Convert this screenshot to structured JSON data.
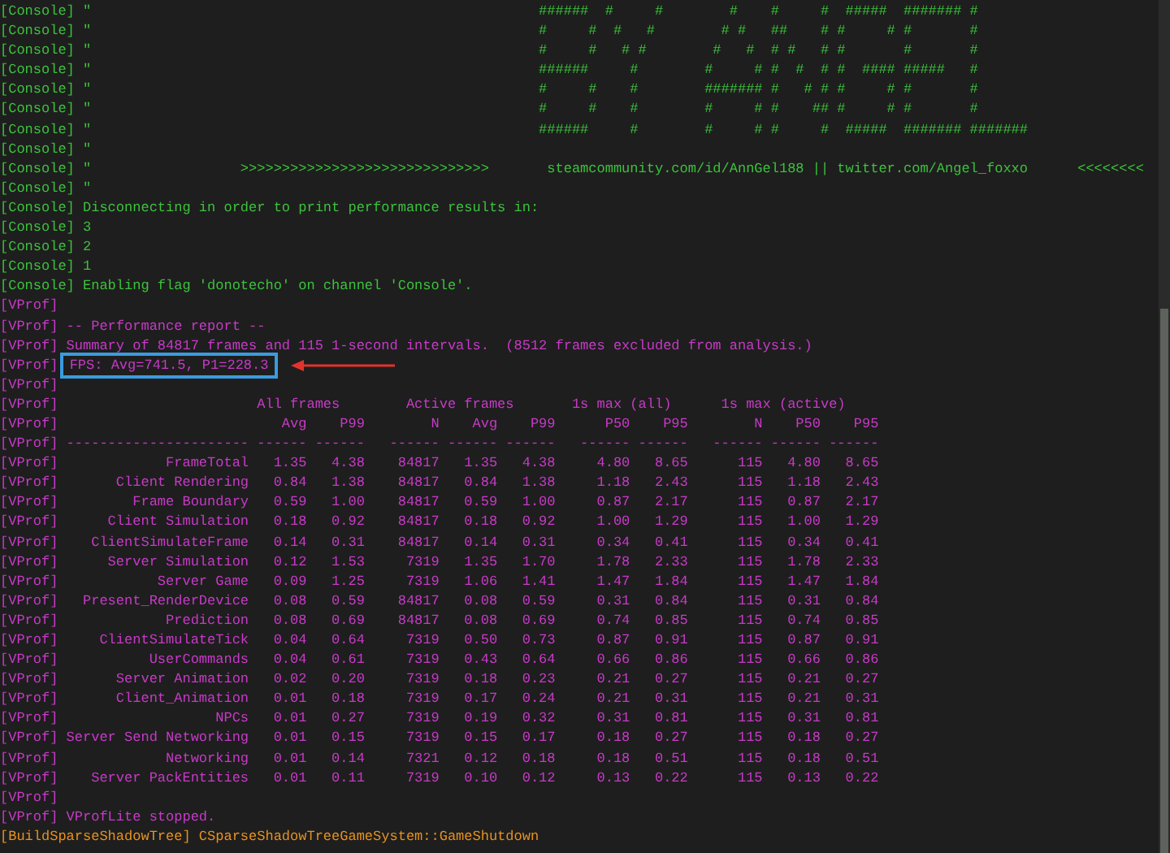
{
  "console_log": [
    {
      "kind": "text",
      "color": "#3cc23c",
      "tag": "[Console]",
      "text": "\"                                                      ######  #     #        #    #     #  #####  ####### #",
      "highlighted": false
    },
    {
      "kind": "text",
      "color": "#3cc23c",
      "tag": "[Console]",
      "text": "\"                                                      #     #  #   #        # #   ##    # #     # #       #",
      "highlighted": false
    },
    {
      "kind": "text",
      "color": "#3cc23c",
      "tag": "[Console]",
      "text": "\"                                                      #     #   # #        #   #  # #   # #       #       #",
      "highlighted": false
    },
    {
      "kind": "text",
      "color": "#3cc23c",
      "tag": "[Console]",
      "text": "\"                                                      ######     #        #     # #  #  # #  #### #####   #",
      "highlighted": false
    },
    {
      "kind": "text",
      "color": "#3cc23c",
      "tag": "[Console]",
      "text": "\"                                                      #     #    #        ####### #   # # #     # #       #",
      "highlighted": false
    },
    {
      "kind": "text",
      "color": "#3cc23c",
      "tag": "[Console]",
      "text": "\"                                                      #     #    #        #     # #    ## #     # #       #",
      "highlighted": false
    },
    {
      "kind": "text",
      "color": "#3cc23c",
      "tag": "[Console]",
      "text": "\"                                                      ######     #        #     # #     #  #####  ####### #######",
      "highlighted": false
    },
    {
      "kind": "text",
      "color": "#3cc23c",
      "tag": "[Console]",
      "text": "\"",
      "highlighted": false
    },
    {
      "kind": "text",
      "color": "#3cc23c",
      "tag": "[Console]",
      "text": "\"                  >>>>>>>>>>>>>>>>>>>>>>>>>>>>>>       steamcommunity.com/id/AnnGel188 || twitter.com/Angel_foxxo      <<<<<<<<",
      "highlighted": false
    },
    {
      "kind": "text",
      "color": "#3cc23c",
      "tag": "[Console]",
      "text": "\"",
      "highlighted": false
    },
    {
      "kind": "text",
      "color": "#3cc23c",
      "tag": "[Console]",
      "text": "Disconnecting in order to print performance results in:",
      "highlighted": false
    },
    {
      "kind": "text",
      "color": "#3cc23c",
      "tag": "[Console]",
      "text": "3",
      "highlighted": false
    },
    {
      "kind": "text",
      "color": "#3cc23c",
      "tag": "[Console]",
      "text": "2",
      "highlighted": false
    },
    {
      "kind": "text",
      "color": "#3cc23c",
      "tag": "[Console]",
      "text": "1",
      "highlighted": false
    },
    {
      "kind": "text",
      "color": "#3cc23c",
      "tag": "[Console]",
      "text": "Enabling flag 'donotecho' on channel 'Console'.",
      "highlighted": false
    },
    {
      "kind": "text",
      "color": "#c83ac8",
      "tag": "[VProf]",
      "highlighted": false
    },
    {
      "kind": "text",
      "color": "#c83ac8",
      "tag": "[VProf]",
      "text": "-- Performance report --",
      "highlighted": false
    },
    {
      "kind": "text",
      "color": "#c83ac8",
      "tag": "[VProf]",
      "text": "Summary of 84817 frames and 115 1-second intervals.  (8512 frames excluded from analysis.)",
      "highlighted": false
    },
    {
      "kind": "text",
      "color": "#c83ac8",
      "tag": "[VProf]",
      "text": "FPS: Avg=741.5, P1=228.3",
      "highlighted": true
    },
    {
      "kind": "text",
      "color": "#c83ac8",
      "tag": "[VProf]",
      "highlighted": false
    },
    {
      "kind": "groups",
      "color": "#c83ac8",
      "tag": "[VProf]",
      "groups": [
        "All frames",
        "Active frames",
        "1s max (all)",
        "1s max (active)"
      ]
    },
    {
      "kind": "columns",
      "color": "#c83ac8",
      "tag": "[VProf]",
      "columns": [
        "Avg",
        "P99",
        "N",
        "Avg",
        "P99",
        "P50",
        "P95",
        "N",
        "P50",
        "P95"
      ]
    },
    {
      "kind": "separator",
      "color": "#c83ac8",
      "tag": "[VProf]",
      "name": "----------------------",
      "values": [
        "------",
        "------",
        "------",
        "------",
        "------",
        "------",
        "------",
        "------",
        "------",
        "------"
      ]
    },
    {
      "kind": "row",
      "color": "#c83ac8",
      "tag": "[VProf]",
      "name": "FrameTotal",
      "values": [
        "1.35",
        "4.38",
        "84817",
        "1.35",
        "4.38",
        "4.80",
        "8.65",
        "115",
        "4.80",
        "8.65"
      ]
    },
    {
      "kind": "row",
      "color": "#c83ac8",
      "tag": "[VProf]",
      "name": "Client Rendering",
      "values": [
        "0.84",
        "1.38",
        "84817",
        "0.84",
        "1.38",
        "1.18",
        "2.43",
        "115",
        "1.18",
        "2.43"
      ]
    },
    {
      "kind": "row",
      "color": "#c83ac8",
      "tag": "[VProf]",
      "name": "Frame Boundary",
      "values": [
        "0.59",
        "1.00",
        "84817",
        "0.59",
        "1.00",
        "0.87",
        "2.17",
        "115",
        "0.87",
        "2.17"
      ]
    },
    {
      "kind": "row",
      "color": "#c83ac8",
      "tag": "[VProf]",
      "name": "Client Simulation",
      "values": [
        "0.18",
        "0.92",
        "84817",
        "0.18",
        "0.92",
        "1.00",
        "1.29",
        "115",
        "1.00",
        "1.29"
      ]
    },
    {
      "kind": "row",
      "color": "#c83ac8",
      "tag": "[VProf]",
      "name": "ClientSimulateFrame",
      "values": [
        "0.14",
        "0.31",
        "84817",
        "0.14",
        "0.31",
        "0.34",
        "0.41",
        "115",
        "0.34",
        "0.41"
      ]
    },
    {
      "kind": "row",
      "color": "#c83ac8",
      "tag": "[VProf]",
      "name": "Server Simulation",
      "values": [
        "0.12",
        "1.53",
        "7319",
        "1.35",
        "1.70",
        "1.78",
        "2.33",
        "115",
        "1.78",
        "2.33"
      ]
    },
    {
      "kind": "row",
      "color": "#c83ac8",
      "tag": "[VProf]",
      "name": "Server Game",
      "values": [
        "0.09",
        "1.25",
        "7319",
        "1.06",
        "1.41",
        "1.47",
        "1.84",
        "115",
        "1.47",
        "1.84"
      ]
    },
    {
      "kind": "row",
      "color": "#c83ac8",
      "tag": "[VProf]",
      "name": "Present_RenderDevice",
      "values": [
        "0.08",
        "0.59",
        "84817",
        "0.08",
        "0.59",
        "0.31",
        "0.84",
        "115",
        "0.31",
        "0.84"
      ]
    },
    {
      "kind": "row",
      "color": "#c83ac8",
      "tag": "[VProf]",
      "name": "Prediction",
      "values": [
        "0.08",
        "0.69",
        "84817",
        "0.08",
        "0.69",
        "0.74",
        "0.85",
        "115",
        "0.74",
        "0.85"
      ]
    },
    {
      "kind": "row",
      "color": "#c83ac8",
      "tag": "[VProf]",
      "name": "ClientSimulateTick",
      "values": [
        "0.04",
        "0.64",
        "7319",
        "0.50",
        "0.73",
        "0.87",
        "0.91",
        "115",
        "0.87",
        "0.91"
      ]
    },
    {
      "kind": "row",
      "color": "#c83ac8",
      "tag": "[VProf]",
      "name": "UserCommands",
      "values": [
        "0.04",
        "0.61",
        "7319",
        "0.43",
        "0.64",
        "0.66",
        "0.86",
        "115",
        "0.66",
        "0.86"
      ]
    },
    {
      "kind": "row",
      "color": "#c83ac8",
      "tag": "[VProf]",
      "name": "Server Animation",
      "values": [
        "0.02",
        "0.20",
        "7319",
        "0.18",
        "0.23",
        "0.21",
        "0.27",
        "115",
        "0.21",
        "0.27"
      ]
    },
    {
      "kind": "row",
      "color": "#c83ac8",
      "tag": "[VProf]",
      "name": "Client_Animation",
      "values": [
        "0.01",
        "0.18",
        "7319",
        "0.17",
        "0.24",
        "0.21",
        "0.31",
        "115",
        "0.21",
        "0.31"
      ]
    },
    {
      "kind": "row",
      "color": "#c83ac8",
      "tag": "[VProf]",
      "name": "NPCs",
      "values": [
        "0.01",
        "0.27",
        "7319",
        "0.19",
        "0.32",
        "0.31",
        "0.81",
        "115",
        "0.31",
        "0.81"
      ]
    },
    {
      "kind": "row",
      "color": "#c83ac8",
      "tag": "[VProf]",
      "name": "Server Send Networking",
      "values": [
        "0.01",
        "0.15",
        "7319",
        "0.15",
        "0.17",
        "0.18",
        "0.27",
        "115",
        "0.18",
        "0.27"
      ]
    },
    {
      "kind": "row",
      "color": "#c83ac8",
      "tag": "[VProf]",
      "name": "Networking",
      "values": [
        "0.01",
        "0.14",
        "7321",
        "0.12",
        "0.18",
        "0.18",
        "0.51",
        "115",
        "0.18",
        "0.51"
      ]
    },
    {
      "kind": "row",
      "color": "#c83ac8",
      "tag": "[VProf]",
      "name": "Server PackEntities",
      "values": [
        "0.01",
        "0.11",
        "7319",
        "0.10",
        "0.12",
        "0.13",
        "0.22",
        "115",
        "0.13",
        "0.22"
      ]
    },
    {
      "kind": "text",
      "color": "#c83ac8",
      "tag": "[VProf]",
      "highlighted": false
    },
    {
      "kind": "text",
      "color": "#c83ac8",
      "tag": "[VProf]",
      "text": "VProfLite stopped.",
      "highlighted": false
    },
    {
      "kind": "text",
      "color": "#e8921e",
      "tag": "[BuildSparseShadowTree]",
      "text": "CSparseShadowTreeGameSystem::GameShutdown",
      "highlighted": false
    }
  ]
}
